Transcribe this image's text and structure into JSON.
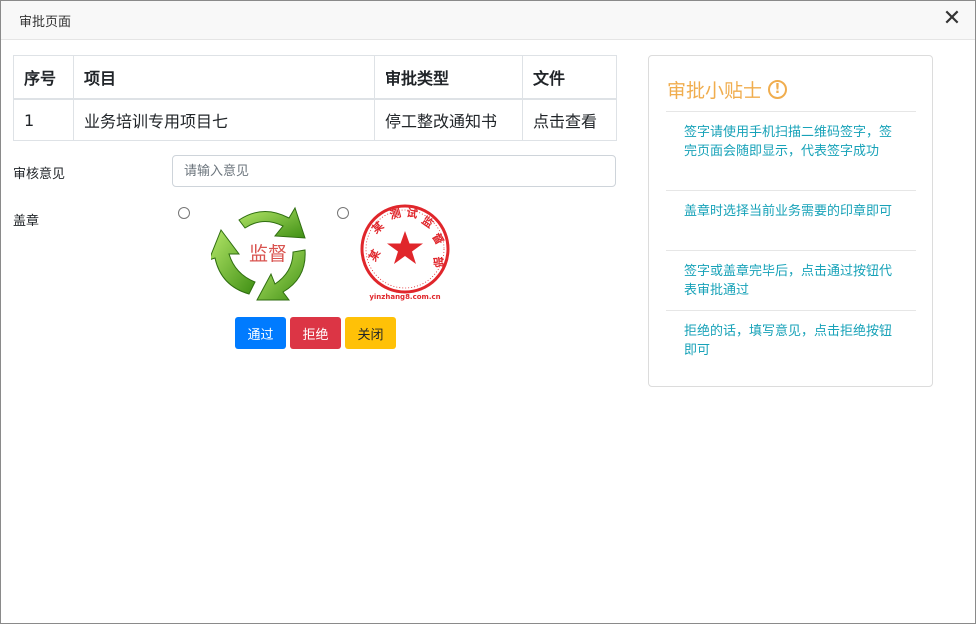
{
  "dialog": {
    "title": "审批页面",
    "close_symbol": "✕"
  },
  "table": {
    "headers": [
      "序号",
      "项目",
      "审批类型",
      "文件"
    ],
    "rows": [
      {
        "index": "1",
        "project": "业务培训专用项目七",
        "type": "停工整改通知书",
        "file": "点击查看"
      }
    ]
  },
  "form": {
    "opinion_label": "审核意见",
    "opinion_placeholder": "请输入意见",
    "opinion_value": "",
    "seal_label": "盖章",
    "seals": [
      {
        "icon": "recycle-arrows-seal-icon",
        "text": "监督",
        "selected": false
      },
      {
        "icon": "red-round-stamp-icon",
        "ring_text": "某某测试监督",
        "footer": "yinzhang8.com.cn",
        "selected": false
      }
    ]
  },
  "buttons": {
    "pass": "通过",
    "reject": "拒绝",
    "close": "关闭"
  },
  "tips": {
    "title": "审批小贴士",
    "icon": "!",
    "items": [
      "签字请使用手机扫描二维码签字，签完页面会随即显示，代表签字成功",
      "盖章时选择当前业务需要的印章即可",
      "签字或盖章完毕后，点击通过按钮代表审批通过",
      "拒绝的话，填写意见，点击拒绝按钮即可"
    ]
  },
  "colors": {
    "primary": "#007bff",
    "danger": "#dc3545",
    "warning": "#ffc107",
    "tip_title": "#f0ad4e",
    "tip_text": "#17a2b8",
    "seal_green": "#5cb82a",
    "seal_red": "#e0262b"
  }
}
